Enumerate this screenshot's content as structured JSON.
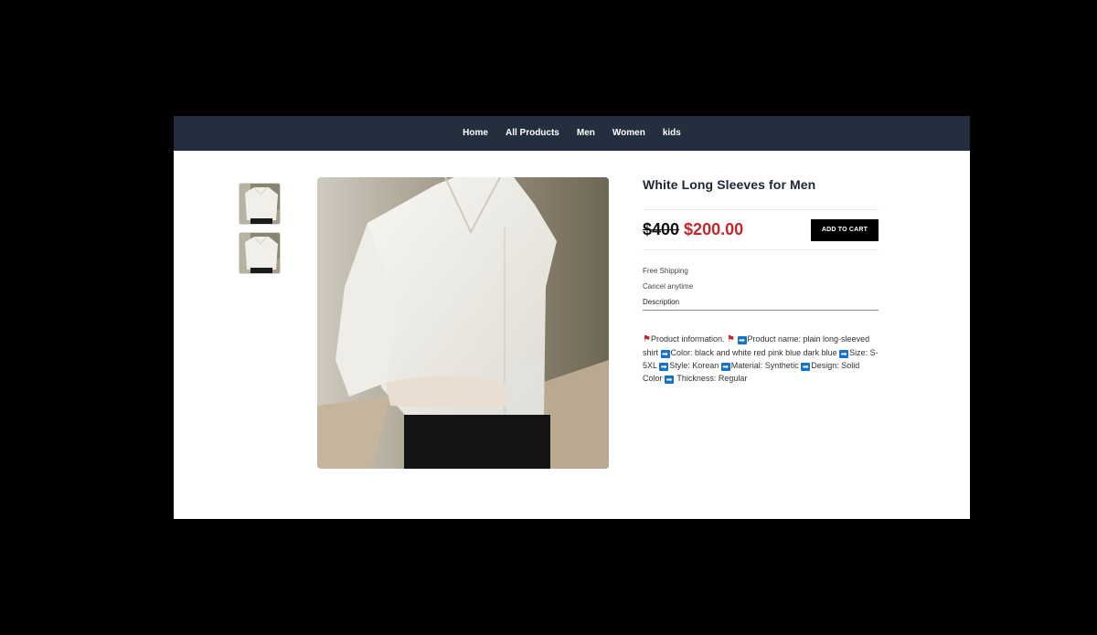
{
  "nav": {
    "items": [
      {
        "label": "Home"
      },
      {
        "label": "All Products"
      },
      {
        "label": "Men"
      },
      {
        "label": "Women"
      },
      {
        "label": "kids"
      }
    ]
  },
  "product": {
    "title": "White Long Sleeves for Men",
    "old_price": "$400",
    "price": "$200.00",
    "add_to_cart": "ADD TO CART",
    "features": [
      "Free Shipping",
      "Cancel anytime"
    ],
    "description_tab": "Description",
    "description": [
      {
        "icon": "flag-icon",
        "text": "Product information. "
      },
      {
        "icon": "flag-icon",
        "text": " "
      },
      {
        "icon": "arrow-icon",
        "text": "Product name: plain long-sleeved shirt "
      },
      {
        "icon": "arrow-icon",
        "text": "Color: black and white red pink blue dark blue "
      },
      {
        "icon": "arrow-icon",
        "text": "Size: S-5XL "
      },
      {
        "icon": "arrow-icon",
        "text": "Style: Korean "
      },
      {
        "icon": "arrow-icon",
        "text": "Material: Synthetic "
      },
      {
        "icon": "arrow-icon",
        "text": "Design: Solid Color "
      },
      {
        "icon": "arrow-icon",
        "text": " Thickness: Regular"
      }
    ]
  },
  "colors": {
    "navbar": "#232f3e",
    "sale_price": "#c1272d",
    "button": "#000000",
    "arrow_icon": "#1572c9"
  }
}
